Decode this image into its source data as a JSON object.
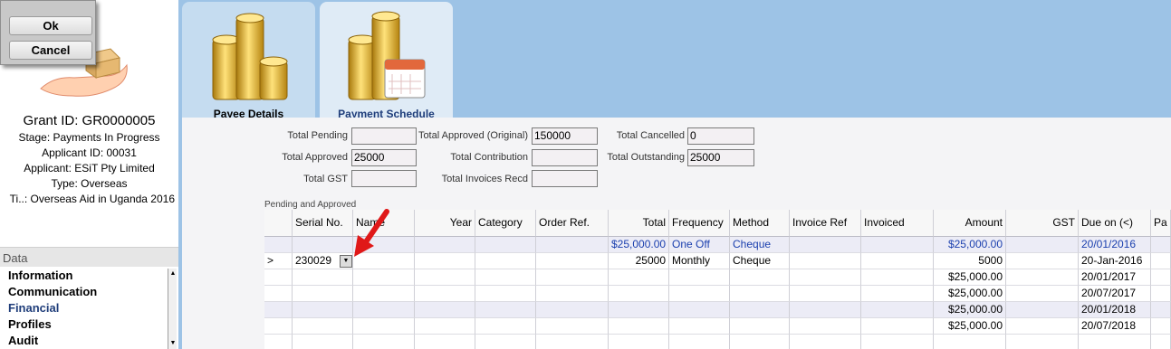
{
  "dialog": {
    "ok_label": "Ok",
    "cancel_label": "Cancel"
  },
  "grant": {
    "id_line": "Grant ID: GR0000005",
    "stage": "Stage: Payments In Progress",
    "applicant_id": "Applicant ID: 00031",
    "applicant": "Applicant: ESiT Pty Limited",
    "type": "Type: Overseas",
    "title": "Ti..: Overseas Aid in Uganda 2016"
  },
  "data_panel": {
    "header": "Data",
    "items": [
      {
        "label": "Information"
      },
      {
        "label": "Communication"
      },
      {
        "label": "Financial"
      },
      {
        "label": "Profiles"
      },
      {
        "label": "Audit"
      }
    ]
  },
  "tabs": [
    {
      "label": "Payee Details"
    },
    {
      "label": "Payment Schedule"
    }
  ],
  "totals": {
    "pending": {
      "label": "Total Pending",
      "value": ""
    },
    "approved": {
      "label": "Total Approved",
      "value": "25000"
    },
    "gst": {
      "label": "Total GST",
      "value": ""
    },
    "approved_original": {
      "label": "Total Approved (Original)",
      "value": "150000"
    },
    "contribution": {
      "label": "Total Contribution",
      "value": ""
    },
    "invoices_recd": {
      "label": "Total Invoices Recd",
      "value": ""
    },
    "cancelled": {
      "label": "Total Cancelled",
      "value": "0"
    },
    "outstanding": {
      "label": "Total Outstanding",
      "value": "25000"
    }
  },
  "grid": {
    "caption": "Pending and Approved",
    "columns": [
      "",
      "Serial No.",
      "Name",
      "Year",
      "Category",
      "Order Ref.",
      "Total",
      "Frequency",
      "Method",
      "Invoice Ref",
      "Invoiced",
      "Amount",
      "GST",
      "Due on (<)",
      "Pa"
    ],
    "rows": [
      {
        "indicator": "",
        "serial": "",
        "name": "",
        "year": "",
        "category": "",
        "order_ref": "",
        "total": "$25,000.00",
        "frequency": "One Off",
        "method": "Cheque",
        "invoice_ref": "",
        "invoiced": "",
        "amount": "$25,000.00",
        "gst": "",
        "due_on": "20/01/2016",
        "pa": ""
      },
      {
        "indicator": ">",
        "serial": "230029",
        "name": "",
        "year": "",
        "category": "",
        "order_ref": "",
        "total": "25000",
        "frequency": "Monthly",
        "method": "Cheque",
        "invoice_ref": "",
        "invoiced": "",
        "amount": "5000",
        "gst": "",
        "due_on": "20-Jan-2016",
        "pa": ""
      },
      {
        "indicator": "",
        "serial": "",
        "name": "",
        "year": "",
        "category": "",
        "order_ref": "",
        "total": "",
        "frequency": "",
        "method": "",
        "invoice_ref": "",
        "invoiced": "",
        "amount": "$25,000.00",
        "gst": "",
        "due_on": "20/01/2017",
        "pa": ""
      },
      {
        "indicator": "",
        "serial": "",
        "name": "",
        "year": "",
        "category": "",
        "order_ref": "",
        "total": "",
        "frequency": "",
        "method": "",
        "invoice_ref": "",
        "invoiced": "",
        "amount": "$25,000.00",
        "gst": "",
        "due_on": "20/07/2017",
        "pa": ""
      },
      {
        "indicator": "",
        "serial": "",
        "name": "",
        "year": "",
        "category": "",
        "order_ref": "",
        "total": "",
        "frequency": "",
        "method": "",
        "invoice_ref": "",
        "invoiced": "",
        "amount": "$25,000.00",
        "gst": "",
        "due_on": "20/01/2018",
        "pa": ""
      },
      {
        "indicator": "",
        "serial": "",
        "name": "",
        "year": "",
        "category": "",
        "order_ref": "",
        "total": "",
        "frequency": "",
        "method": "",
        "invoice_ref": "",
        "invoiced": "",
        "amount": "$25,000.00",
        "gst": "",
        "due_on": "20/07/2018",
        "pa": ""
      },
      {
        "indicator": "",
        "serial": "",
        "name": "",
        "year": "",
        "category": "",
        "order_ref": "",
        "total": "",
        "frequency": "",
        "method": "",
        "invoice_ref": "",
        "invoiced": "",
        "amount": "",
        "gst": "",
        "due_on": "",
        "pa": ""
      }
    ]
  },
  "icons": {
    "pointer": "red-arrow-icon",
    "dropdown": "dropdown-arrow-icon",
    "coins": "gold-coins-icon",
    "calendar": "calendar-icon"
  },
  "colors": {
    "accent": "#1f3d7a",
    "row_blue": "#1a3fae",
    "background": "#9dc3e6"
  }
}
